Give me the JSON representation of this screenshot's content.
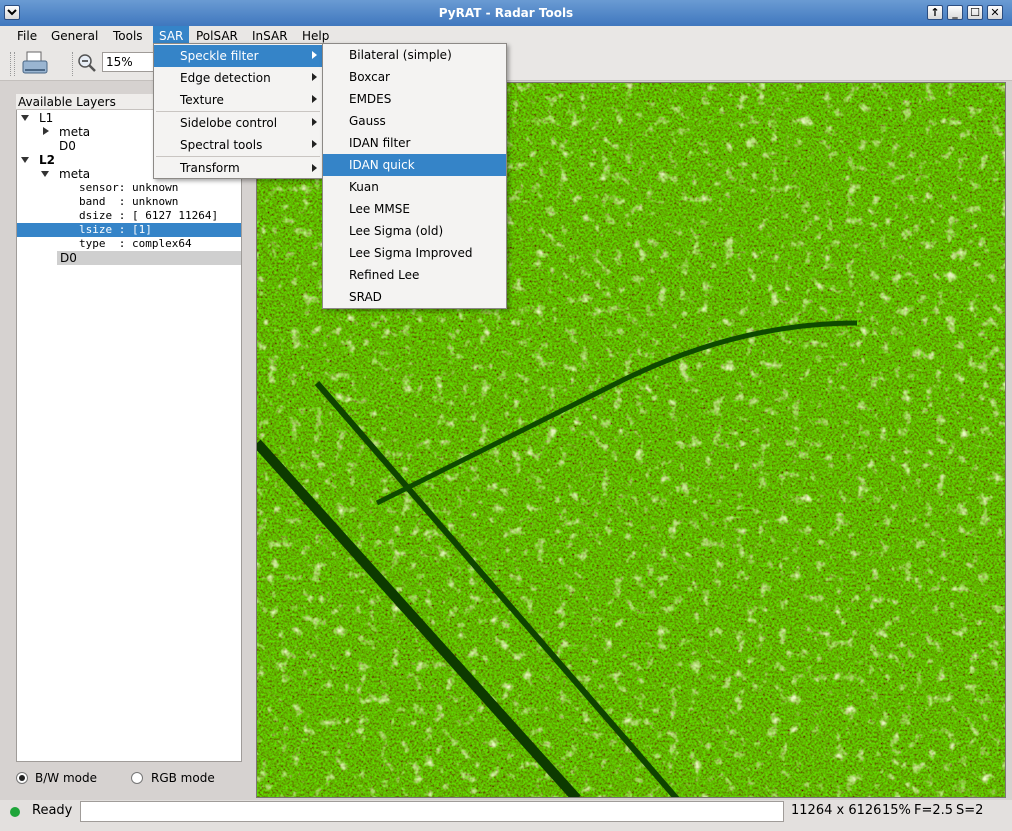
{
  "window": {
    "title": "PyRAT - Radar Tools",
    "buttons": [
      "↑",
      "_",
      "☐",
      "✕"
    ]
  },
  "menubar": {
    "items": [
      "File",
      "General",
      "Tools",
      "SAR",
      "PolSAR",
      "InSAR",
      "Help"
    ],
    "active": "SAR"
  },
  "toolbar": {
    "zoom_value": "15%"
  },
  "layers": {
    "header": "Available Layers",
    "tree": [
      {
        "text": "L1"
      },
      {
        "text": "meta"
      },
      {
        "text": "D0"
      },
      {
        "text": "L2"
      },
      {
        "text": "meta"
      },
      {
        "text": "sensor: unknown"
      },
      {
        "text": "band  : unknown"
      },
      {
        "text": "dsize : [ 6127 11264]"
      },
      {
        "text": "lsize : [1]"
      },
      {
        "text": "type  : complex64"
      },
      {
        "text": "D0"
      }
    ]
  },
  "modes": {
    "bw_label": "B/W mode",
    "rgb_label": "RGB mode",
    "selected": "B/W mode"
  },
  "sar_menu": {
    "items": [
      "Speckle filter",
      "Edge detection",
      "Texture",
      "Sidelobe control",
      "Spectral tools",
      "Transform"
    ],
    "highlighted": "Speckle filter"
  },
  "speckle_menu": {
    "items": [
      "Bilateral (simple)",
      "Boxcar",
      "EMDES",
      "Gauss",
      "IDAN filter",
      "IDAN quick",
      "Kuan",
      "Lee MMSE",
      "Lee Sigma (old)",
      "Lee Sigma Improved",
      "Refined Lee",
      "SRAD"
    ],
    "highlighted": "IDAN quick"
  },
  "status": {
    "text": "Ready",
    "dimensions": "11264 x 6126",
    "zoom": "15%",
    "f_value": "F=2.5",
    "s_value": "S=2"
  },
  "colors": {
    "accent": "#3584c8",
    "titlebar": "#4a82c6",
    "status_dot": "#1fa53a"
  }
}
